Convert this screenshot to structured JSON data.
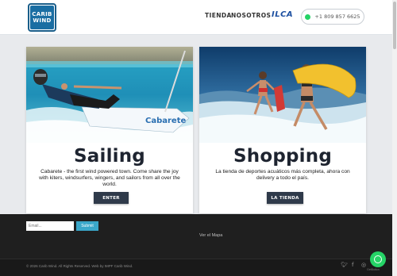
{
  "header": {
    "logo_line1": "CARIB",
    "logo_line2": "WIND",
    "nav": [
      "TIENDA",
      "NOSOTROS",
      "ILCA"
    ],
    "phone": "+1 809 857 6625"
  },
  "cards": [
    {
      "title": "Sailing",
      "description": "Cabarete - the first wind powered town. Come share the joy with kiters, windsurfers, wingers, and sailors from all over the world.",
      "button": "ENTER",
      "image_alt": "sailor-on-dinghy",
      "boat_text": "Cabarete"
    },
    {
      "title": "Shopping",
      "description": "La tienda de deportes acuáticos más completa, ahora con delivery a todo el país.",
      "button": "LA TIENDA",
      "image_alt": "surfers-running-into-waves"
    }
  ],
  "footer": {
    "email_placeholder": "Email...",
    "submit_label": "Submit",
    "map_link": "Ver el Mapa",
    "copyright": "© 2026 Carib Wind. All Rights Reserved. Web by IMPF Carib Wind.",
    "social_icons": [
      "twitter-icon",
      "facebook-icon",
      "instagram-icon"
    ],
    "whatsapp_caption": "GetButton"
  },
  "colors": {
    "accent": "#1a6ea3",
    "button_dark": "#2f3a4a",
    "whatsapp": "#25d366",
    "submit": "#3aa7c9"
  }
}
